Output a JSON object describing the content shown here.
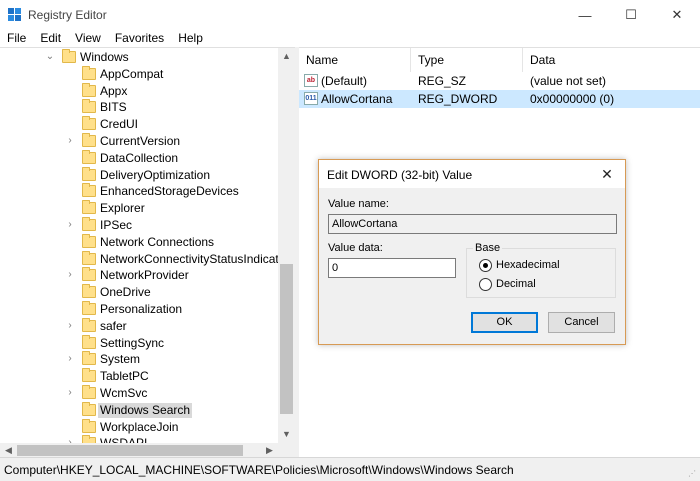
{
  "window": {
    "title": "Registry Editor",
    "controls": {
      "minimize": "—",
      "maximize": "☐",
      "close": "✕"
    }
  },
  "menu": [
    "File",
    "Edit",
    "View",
    "Favorites",
    "Help"
  ],
  "tree": {
    "items": [
      {
        "label": "Windows",
        "chevron": "⌄",
        "depth": 0
      },
      {
        "label": "AppCompat",
        "chevron": "",
        "depth": 1
      },
      {
        "label": "Appx",
        "chevron": "",
        "depth": 1
      },
      {
        "label": "BITS",
        "chevron": "",
        "depth": 1
      },
      {
        "label": "CredUI",
        "chevron": "",
        "depth": 1
      },
      {
        "label": "CurrentVersion",
        "chevron": "›",
        "depth": 1
      },
      {
        "label": "DataCollection",
        "chevron": "",
        "depth": 1
      },
      {
        "label": "DeliveryOptimization",
        "chevron": "",
        "depth": 1
      },
      {
        "label": "EnhancedStorageDevices",
        "chevron": "",
        "depth": 1
      },
      {
        "label": "Explorer",
        "chevron": "",
        "depth": 1
      },
      {
        "label": "IPSec",
        "chevron": "›",
        "depth": 1
      },
      {
        "label": "Network Connections",
        "chevron": "",
        "depth": 1
      },
      {
        "label": "NetworkConnectivityStatusIndicator",
        "chevron": "",
        "depth": 1
      },
      {
        "label": "NetworkProvider",
        "chevron": "›",
        "depth": 1
      },
      {
        "label": "OneDrive",
        "chevron": "",
        "depth": 1
      },
      {
        "label": "Personalization",
        "chevron": "",
        "depth": 1
      },
      {
        "label": "safer",
        "chevron": "›",
        "depth": 1
      },
      {
        "label": "SettingSync",
        "chevron": "",
        "depth": 1
      },
      {
        "label": "System",
        "chevron": "›",
        "depth": 1
      },
      {
        "label": "TabletPC",
        "chevron": "",
        "depth": 1
      },
      {
        "label": "WcmSvc",
        "chevron": "›",
        "depth": 1
      },
      {
        "label": "Windows Search",
        "chevron": "",
        "depth": 1,
        "selected": true
      },
      {
        "label": "WorkplaceJoin",
        "chevron": "",
        "depth": 1
      },
      {
        "label": "WSDAPI",
        "chevron": "›",
        "depth": 1
      }
    ]
  },
  "list": {
    "headers": {
      "name": "Name",
      "type": "Type",
      "data": "Data"
    },
    "rows": [
      {
        "icon": "ab",
        "name": "(Default)",
        "type": "REG_SZ",
        "data": "(value not set)"
      },
      {
        "icon": "011",
        "name": "AllowCortana",
        "type": "REG_DWORD",
        "data": "0x00000000 (0)",
        "selected": true
      }
    ]
  },
  "status": {
    "path": "Computer\\HKEY_LOCAL_MACHINE\\SOFTWARE\\Policies\\Microsoft\\Windows\\Windows Search"
  },
  "dialog": {
    "title": "Edit DWORD (32-bit) Value",
    "close": "✕",
    "value_name_label": "Value name:",
    "value_name": "AllowCortana",
    "value_data_label": "Value data:",
    "value_data": "0",
    "base_label": "Base",
    "base_options": {
      "hex": "Hexadecimal",
      "dec": "Decimal"
    },
    "ok": "OK",
    "cancel": "Cancel"
  },
  "scroll_arrows": {
    "up": "▲",
    "down": "▼",
    "left": "◀",
    "right": "▶"
  },
  "colors": {
    "selection": "#cce8ff",
    "tree_selection": "#d9d9d9",
    "dialog_border": "#d79a54",
    "accent": "#0078d7"
  }
}
